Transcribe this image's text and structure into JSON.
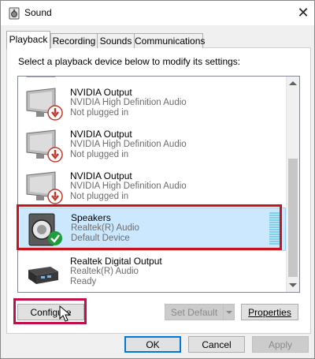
{
  "window": {
    "title": "Sound",
    "close_label": "✕"
  },
  "tabs": [
    {
      "label": "Playback",
      "active": true
    },
    {
      "label": "Recording",
      "active": false
    },
    {
      "label": "Sounds",
      "active": false
    },
    {
      "label": "Communications",
      "active": false
    }
  ],
  "instruction": "Select a playback device below to modify its settings:",
  "devices": [
    {
      "name": "NVIDIA Output",
      "driver": "NVIDIA High Definition Audio",
      "status": "Not plugged in",
      "icon": "monitor-icon",
      "badge": "unplugged-badge-icon"
    },
    {
      "name": "NVIDIA Output",
      "driver": "NVIDIA High Definition Audio",
      "status": "Not plugged in",
      "icon": "monitor-icon",
      "badge": "unplugged-badge-icon"
    },
    {
      "name": "NVIDIA Output",
      "driver": "NVIDIA High Definition Audio",
      "status": "Not plugged in",
      "icon": "monitor-icon",
      "badge": "unplugged-badge-icon"
    },
    {
      "name": "Speakers",
      "driver": "Realtek(R) Audio",
      "status": "Default Device",
      "icon": "speaker-icon",
      "badge": "default-check-icon",
      "selected": true
    },
    {
      "name": "Realtek Digital Output",
      "driver": "Realtek(R) Audio",
      "status": "Ready",
      "icon": "digital-output-icon"
    }
  ],
  "buttons": {
    "configure": "Configure",
    "set_default": "Set Default",
    "properties": "Properties",
    "ok": "OK",
    "cancel": "Cancel",
    "apply": "Apply"
  },
  "colors": {
    "selection": "#cce8ff",
    "highlight_red": "#c4161c",
    "highlight_pink": "#c01048",
    "default_check": "#1e9e3a",
    "unplugged_badge": "#c0392b"
  }
}
